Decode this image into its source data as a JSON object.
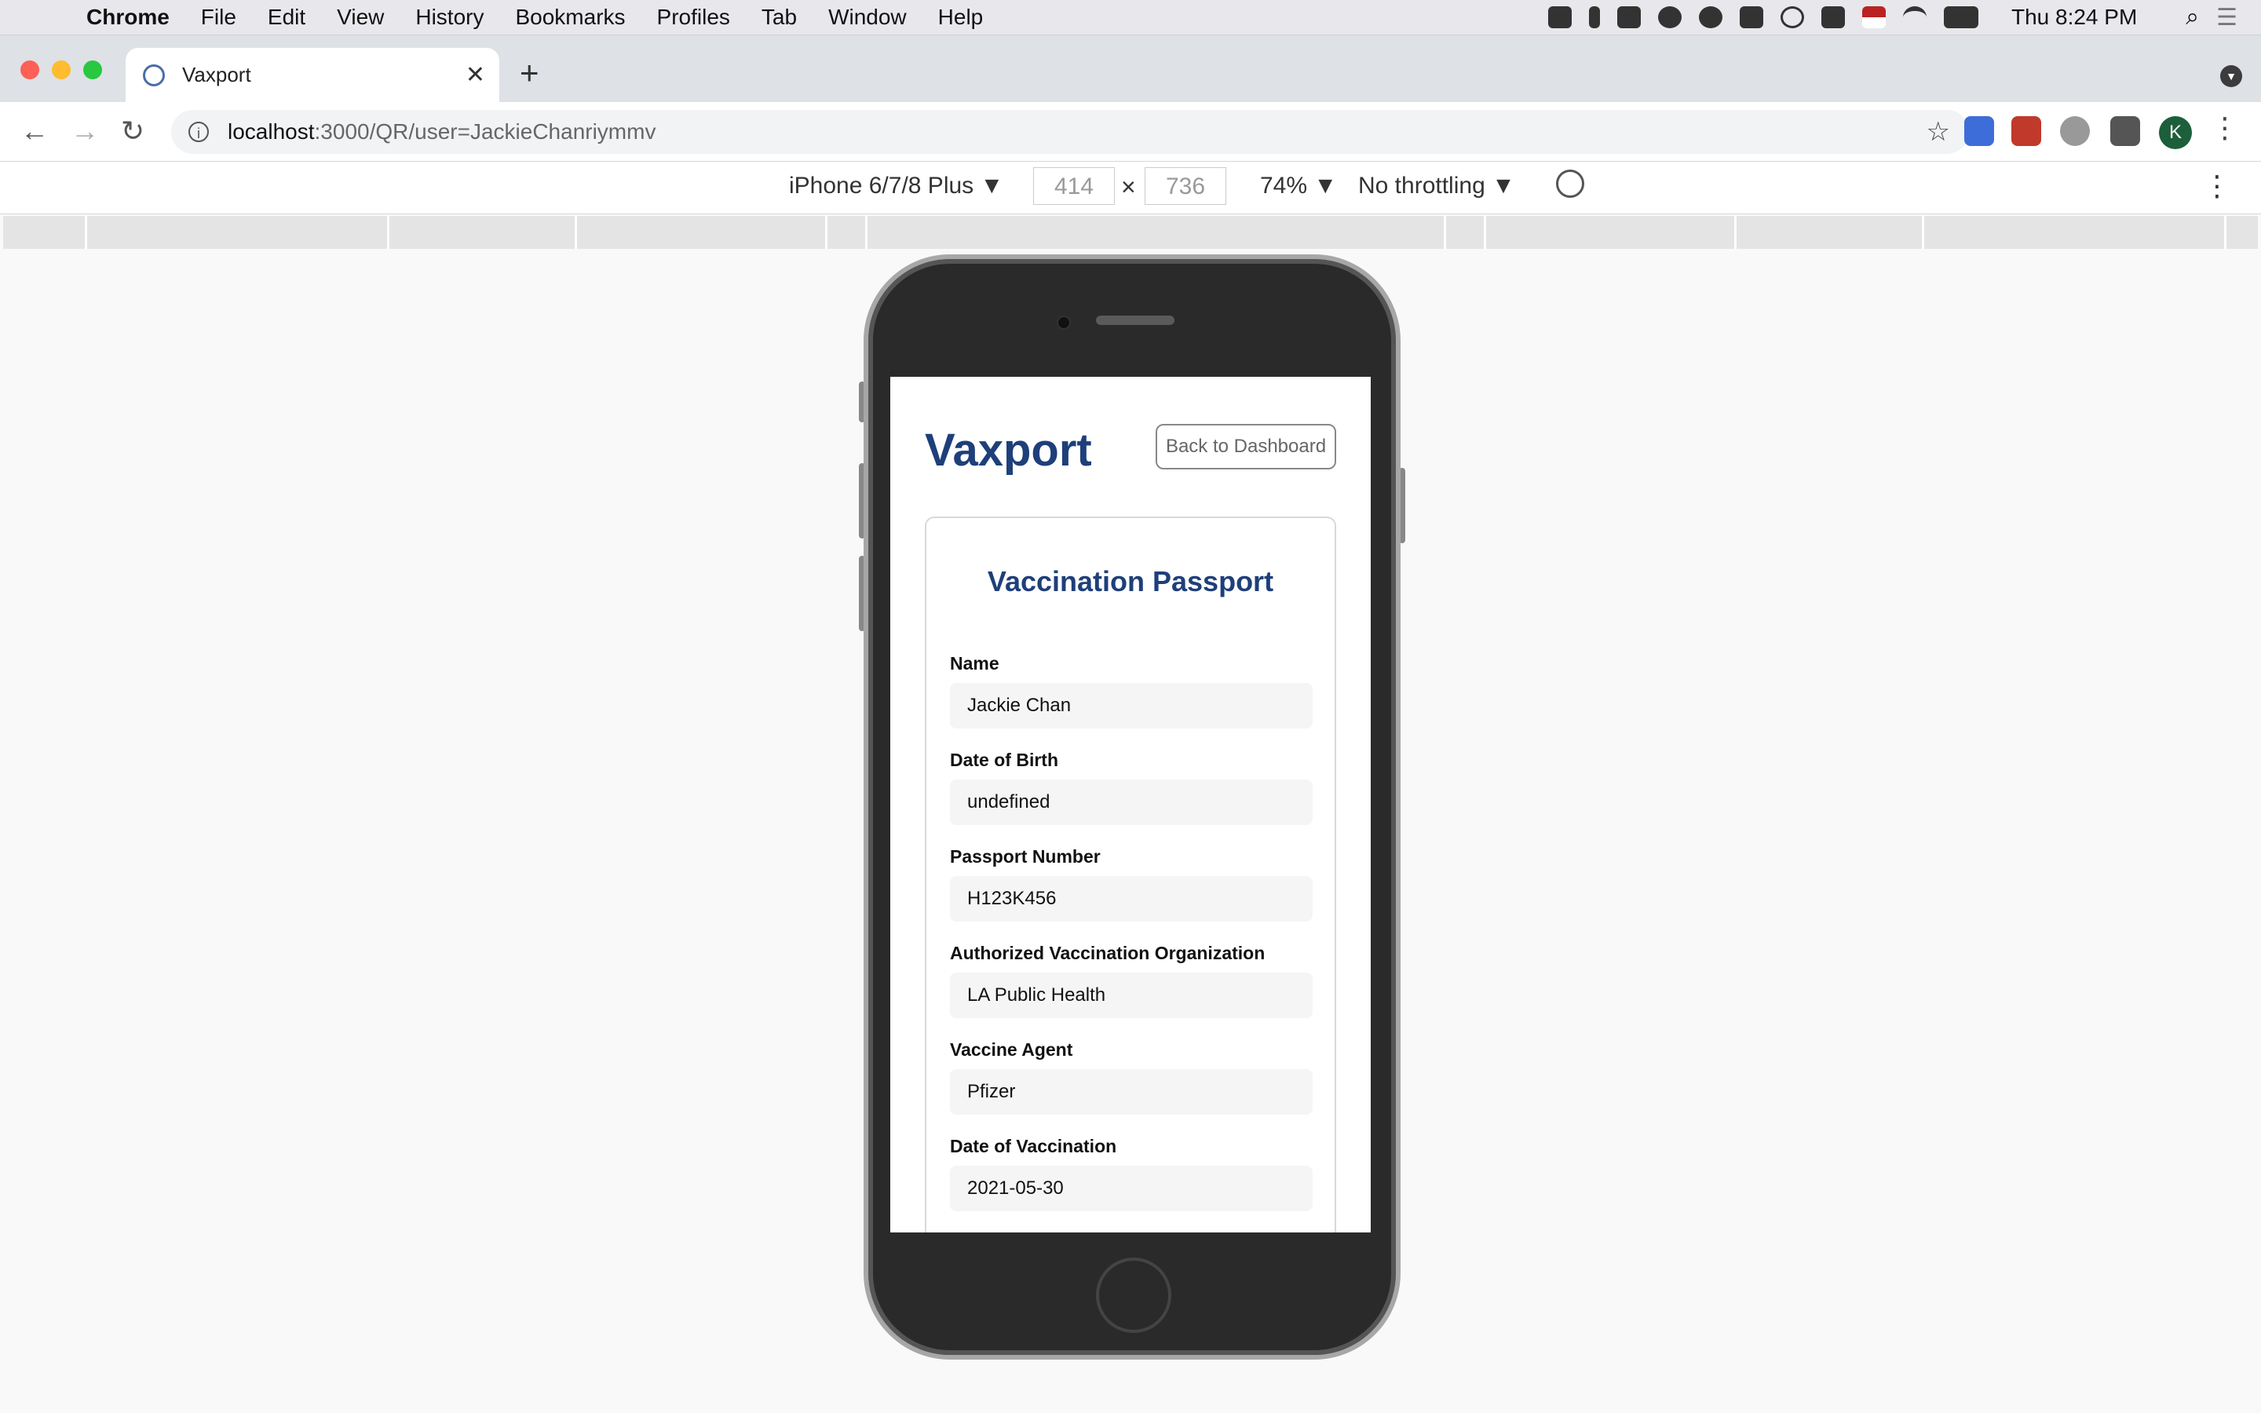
{
  "menubar": {
    "app_name": "Chrome",
    "items": [
      "File",
      "Edit",
      "View",
      "History",
      "Bookmarks",
      "Profiles",
      "Tab",
      "Window",
      "Help"
    ],
    "clock": "Thu 8:24 PM"
  },
  "browser": {
    "tab_title": "Vaxport",
    "url_host": "localhost",
    "url_path": ":3000/QR/user=JackieChanriymmv",
    "profile_initial": "K"
  },
  "device_toolbar": {
    "device": "iPhone 6/7/8 Plus ▼",
    "width": "414",
    "height": "736",
    "times": "×",
    "zoom": "74% ▼",
    "throttling": "No throttling ▼"
  },
  "app": {
    "brand": "Vaxport",
    "back_button": "Back to Dashboard",
    "card_title": "Vaccination Passport",
    "fields": [
      {
        "label": "Name",
        "value": "Jackie Chan"
      },
      {
        "label": "Date of Birth",
        "value": "undefined"
      },
      {
        "label": "Passport Number",
        "value": "H123K456"
      },
      {
        "label": "Authorized Vaccination Organization",
        "value": "LA Public Health"
      },
      {
        "label": "Vaccine Agent",
        "value": "Pfizer"
      },
      {
        "label": "Date of Vaccination",
        "value": "2021-05-30"
      }
    ]
  },
  "colors": {
    "brand": "#1e3f7a",
    "field_bg": "#f5f5f5"
  }
}
